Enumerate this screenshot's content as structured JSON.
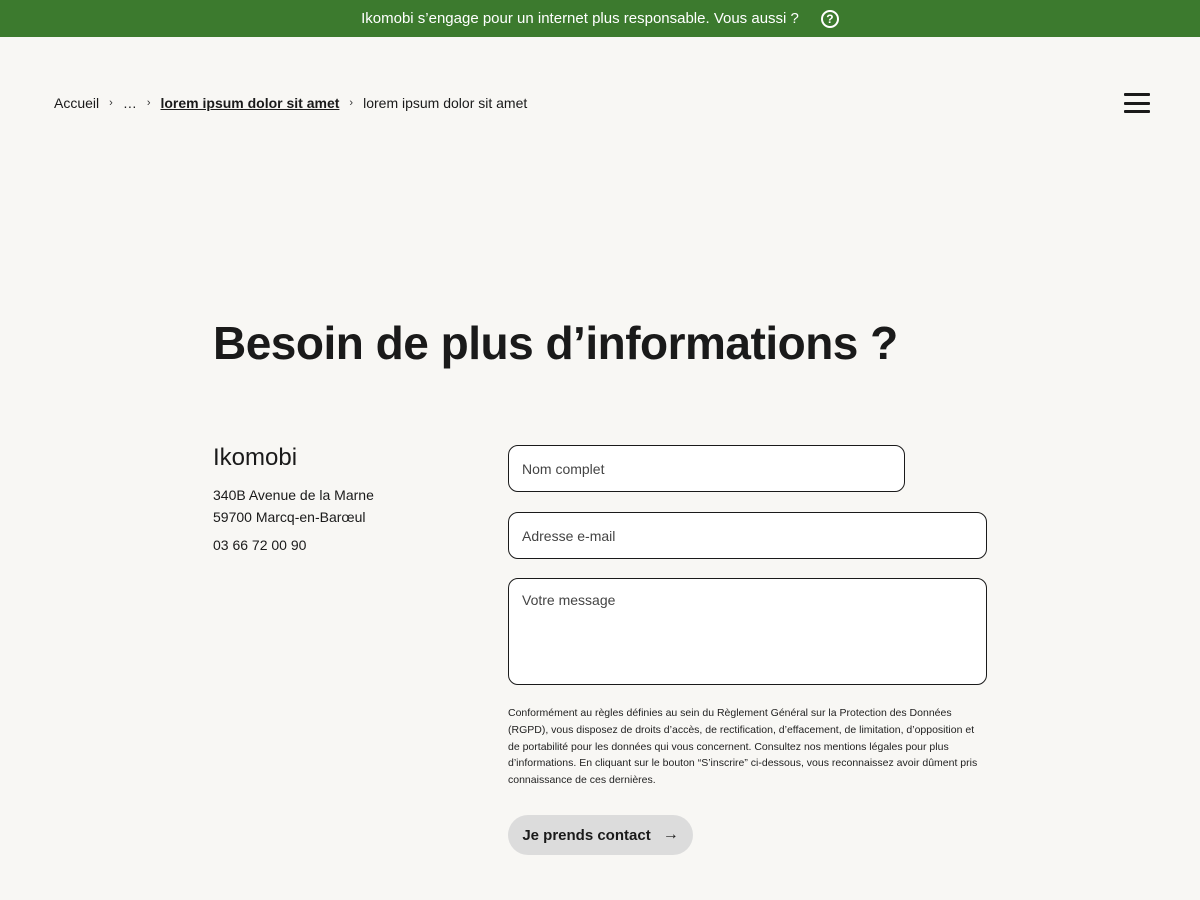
{
  "banner": {
    "text": "Ikomobi s’engage pour un internet plus responsable. Vous aussi  ?",
    "help_icon": "question-circle-icon"
  },
  "breadcrumb": {
    "home": "Accueil",
    "ellipsis": "…",
    "parent": "lorem ipsum dolor sit amet",
    "current": "lorem ipsum dolor sit amet",
    "separator_icon": "chevron-right-icon"
  },
  "header": {
    "menu_icon": "hamburger-menu-icon"
  },
  "main": {
    "title": "Besoin de plus d’informations ?"
  },
  "company": {
    "name": "Ikomobi",
    "address_line1": "340B Avenue de la Marne",
    "address_line2": "59700 Marcq-en-Barœul",
    "phone": "03 66 72 00 90"
  },
  "form": {
    "name_placeholder": "Nom complet",
    "email_placeholder": "Adresse e-mail",
    "message_placeholder": "Votre message",
    "legal_text": "Conformément au règles définies au sein du Règlement Général sur la Protection des Données (RGPD), vous disposez de droits d’accès, de rectification, d’effacement, de limitation, d’opposition et de portabilité pour les données qui vous concernent. Consultez nos mentions légales pour plus d’informations. En cliquant sur le bouton “S’inscrire” ci-dessous, vous reconnaissez avoir dûment pris connaissance de ces dernières.",
    "submit_label": "Je prends contact",
    "submit_icon": "arrow-right-icon"
  },
  "colors": {
    "banner_bg": "#3c7a2e",
    "page_bg": "#f8f7f4",
    "button_bg": "#dcdcdc"
  }
}
